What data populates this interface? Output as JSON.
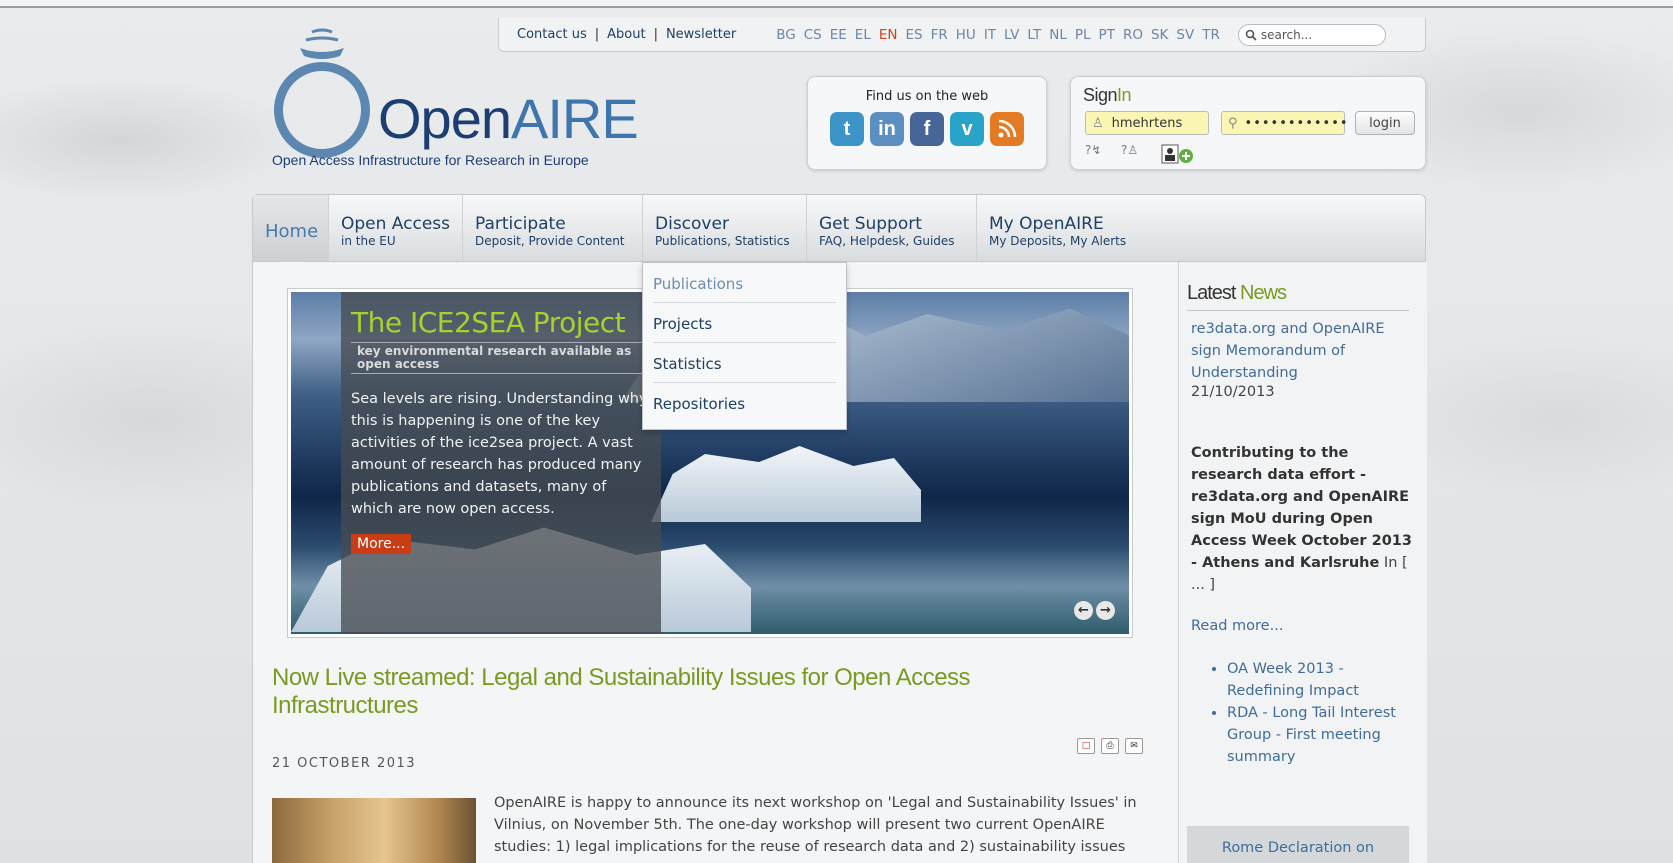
{
  "topbar": {
    "links": [
      "Contact us",
      "About",
      "Newsletter"
    ],
    "languages": [
      "BG",
      "CS",
      "EE",
      "EL",
      "EN",
      "ES",
      "FR",
      "HU",
      "IT",
      "LV",
      "LT",
      "NL",
      "PL",
      "PT",
      "RO",
      "SK",
      "SV",
      "TR"
    ],
    "active_language": "EN",
    "search_placeholder": "search..."
  },
  "logo": {
    "brand_open": "Open",
    "brand_aire": "AIRE",
    "tagline": "Open Access Infrastructure for Research in Europe"
  },
  "social": {
    "title": "Find us on the web",
    "icons": [
      "twitter-icon",
      "linkedin-icon",
      "facebook-icon",
      "vimeo-icon",
      "rss-icon"
    ]
  },
  "signin": {
    "title_a": "Sign",
    "title_b": "In",
    "username": "hmehrtens",
    "password": "••••••••••••",
    "login_label": "login"
  },
  "nav": [
    {
      "main": "Home",
      "sub": ""
    },
    {
      "main": "Open Access",
      "sub": "in the EU"
    },
    {
      "main": "Participate",
      "sub": "Deposit, Provide Content"
    },
    {
      "main": "Discover",
      "sub": "Publications, Statistics"
    },
    {
      "main": "Get Support",
      "sub": "FAQ, Helpdesk, Guides"
    },
    {
      "main": "My OpenAIRE",
      "sub": "My Deposits, My Alerts"
    }
  ],
  "dropdown": [
    "Publications",
    "Projects",
    "Statistics",
    "Repositories"
  ],
  "slider": {
    "title": "The ICE2SEA Project",
    "subtitle": "key environmental research available as open access",
    "body": "Sea levels are rising. Understanding why this is happening is one of the key activities of the ice2sea project. A vast amount of research has produced many publications and datasets, many of which are now open access.",
    "more": "More..."
  },
  "article": {
    "title": "Now Live streamed: Legal and Sustainability Issues for Open Access Infrastructures",
    "date": "21 OCTOBER 2013",
    "body": "OpenAIRE is happy to announce its next workshop on 'Legal and Sustainability Issues' in Vilnius, on November 5th. The one-day workshop will present two current OpenAIRE studies: 1) legal implications for the reuse of research data and 2)  sustainability issues"
  },
  "sidebar": {
    "title_a": "Latest ",
    "title_b": "News",
    "news1": "re3data.org and OpenAIRE sign Memorandum of Understanding",
    "news1_date": "21/10/2013",
    "news2_bold": "Contributing to the research data effort - re3data.org and OpenAIRE sign MoU during Open Access Week October 2013 - Athens and Karlsruhe",
    "news2_rest": " In  [ ... ]",
    "read_more": "Read more...",
    "bullets": [
      "OA Week 2013 - Redefining Impact",
      "RDA - Long Tail Interest Group - First meeting summary"
    ],
    "rome": "Rome Declaration on"
  }
}
